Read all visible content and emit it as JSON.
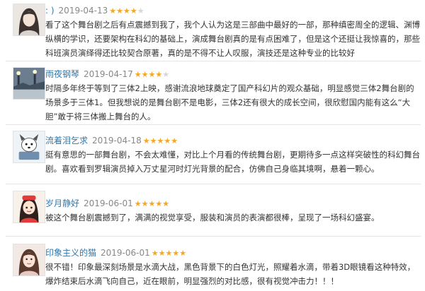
{
  "reviews": [
    {
      "user": ": )",
      "date": "2019-04-13",
      "rating": 4,
      "text": "看了这个舞台剧之后有点震撼到我了，我个人认为这是三部曲中最好的一部，那种缜密周全的逻辑、渊博纵横的学识，还要架构在科幻的基础上，演成舞台剧真的是有点困难了，但是这个还挺让我惊喜的，那些科班演员演绎得还比较契合原著，真的是不得不让人叹服，演技还是这种专业的比较好",
      "avatar_icon": "girl-portrait-icon"
    },
    {
      "user": "雨夜钢琴",
      "date": "2019-04-17",
      "rating": 4,
      "text": "时隔多年终于等到了三体2上映，感谢流浪地球奠定了国产科幻片的观众基础，明显感觉三体2舞台剧的场景多于三体1。但我想说的是舞台剧不是电影，三体2还有很大的成长空间，很欣慰国内能有这么“大胆”敢于将三体搬上舞台的人。",
      "avatar_icon": "night-street-icon"
    },
    {
      "user": "流着泪乞求",
      "date": "2019-04-18",
      "rating": 5,
      "text": "挺有意思的一部舞台剧，不会太难懂，对比上个月看的传统舞台剧，更期待多一点这样突破性的科幻舞台剧。喜欢看到罗辑演员掉入万丈星河时灯光背景的配合，仿佛自己身临其境啊，悬着一颗心。",
      "avatar_icon": "cartoon-dog-icon"
    },
    {
      "user": "岁月静好",
      "date": "2019-06-01",
      "rating": 5,
      "text": "被这个舞台剧震撼到了，满满的视觉享受，服装和演员的表演都很棒，呈现了一场科幻盛宴。",
      "avatar_icon": "cartoon-girl-icon"
    },
    {
      "user": "印象主义的猫",
      "date": "2019-06-01",
      "rating": 5,
      "text": "很不错！印象最深刻场景是水滴大战，黑色背景下的白色灯光，照耀着水滴，带着3D眼镜看这种特效，爆炸结束后水滴飞向自己，近在眼前，明显强烈的对比感，很有视觉冲击力！！！",
      "avatar_icon": "girl-selfie-icon"
    }
  ],
  "colors": {
    "username": "#3377aa",
    "star_on": "#f5a623",
    "star_off": "#d6d6d6"
  }
}
